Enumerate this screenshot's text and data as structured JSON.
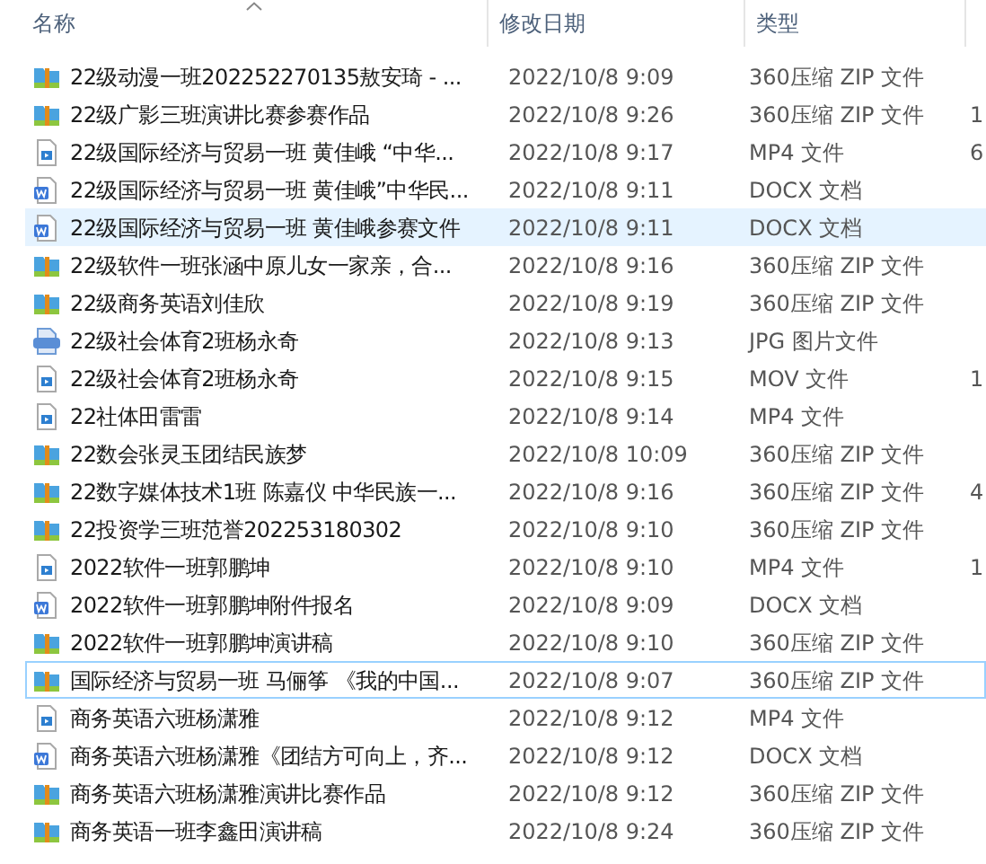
{
  "columns": [
    {
      "label": "名称"
    },
    {
      "label": "修改日期"
    },
    {
      "label": "类型"
    }
  ],
  "rows": [
    {
      "name": "22级动漫一班202252270135敖安琦 - ...",
      "date": "2022/10/8 9:09",
      "type": "360压缩 ZIP 文件",
      "kind": "zip",
      "selected": false,
      "focused": false
    },
    {
      "name": "22级广影三班演讲比赛参赛作品",
      "date": "2022/10/8 9:26",
      "type": "360压缩 ZIP 文件",
      "size": "1",
      "kind": "zip",
      "selected": false,
      "focused": false
    },
    {
      "name": "22级国际经济与贸易一班 黄佳峨 “中华...",
      "date": "2022/10/8 9:17",
      "type": "MP4 文件",
      "size": "6",
      "kind": "video",
      "selected": false,
      "focused": false
    },
    {
      "name": "22级国际经济与贸易一班 黄佳峨”中华民...",
      "date": "2022/10/8 9:11",
      "type": "DOCX 文档",
      "kind": "docx",
      "selected": false,
      "focused": false
    },
    {
      "name": "22级国际经济与贸易一班 黄佳峨参赛文件",
      "date": "2022/10/8 9:11",
      "type": "DOCX 文档",
      "kind": "docx",
      "selected": true,
      "focused": false
    },
    {
      "name": "22级软件一班张涵中原儿女一家亲，合...",
      "date": "2022/10/8 9:16",
      "type": "360压缩 ZIP 文件",
      "kind": "zip",
      "selected": false,
      "focused": false
    },
    {
      "name": "22级商务英语刘佳欣",
      "date": "2022/10/8 9:19",
      "type": "360压缩 ZIP 文件",
      "kind": "zip",
      "selected": false,
      "focused": false
    },
    {
      "name": "22级社会体育2班杨永奇",
      "date": "2022/10/8 9:13",
      "type": "JPG 图片文件",
      "kind": "jpg",
      "selected": false,
      "focused": false
    },
    {
      "name": "22级社会体育2班杨永奇",
      "date": "2022/10/8 9:15",
      "type": "MOV 文件",
      "size": "1",
      "kind": "video",
      "selected": false,
      "focused": false
    },
    {
      "name": "22社体田雷雷",
      "date": "2022/10/8 9:14",
      "type": "MP4 文件",
      "kind": "video",
      "selected": false,
      "focused": false
    },
    {
      "name": "22数会张灵玉团结民族梦",
      "date": "2022/10/8 10:09",
      "type": "360压缩 ZIP 文件",
      "kind": "zip",
      "selected": false,
      "focused": false
    },
    {
      "name": "22数字媒体技术1班 陈嘉仪 中华民族一...",
      "date": "2022/10/8 9:16",
      "type": "360压缩 ZIP 文件",
      "size": "4",
      "kind": "zip",
      "selected": false,
      "focused": false
    },
    {
      "name": "22投资学三班范誉202253180302",
      "date": "2022/10/8 9:10",
      "type": "360压缩 ZIP 文件",
      "kind": "zip",
      "selected": false,
      "focused": false
    },
    {
      "name": "2022软件一班郭鹏坤",
      "date": "2022/10/8 9:10",
      "type": "MP4 文件",
      "size": "1",
      "kind": "video",
      "selected": false,
      "focused": false
    },
    {
      "name": "2022软件一班郭鹏坤附件报名",
      "date": "2022/10/8 9:09",
      "type": "DOCX 文档",
      "kind": "docx",
      "selected": false,
      "focused": false
    },
    {
      "name": "2022软件一班郭鹏坤演讲稿",
      "date": "2022/10/8 9:10",
      "type": "360压缩 ZIP 文件",
      "kind": "zip",
      "selected": false,
      "focused": false
    },
    {
      "name": "国际经济与贸易一班 马俪筝 《我的中国...",
      "date": "2022/10/8 9:07",
      "type": "360压缩 ZIP 文件",
      "kind": "zip",
      "selected": false,
      "focused": true
    },
    {
      "name": "商务英语六班杨潇雅",
      "date": "2022/10/8 9:12",
      "type": "MP4 文件",
      "kind": "video",
      "selected": false,
      "focused": false
    },
    {
      "name": "商务英语六班杨潇雅《团结方可向上，齐...",
      "date": "2022/10/8 9:12",
      "type": "DOCX 文档",
      "kind": "docx",
      "selected": false,
      "focused": false
    },
    {
      "name": "商务英语六班杨潇雅演讲比赛作品",
      "date": "2022/10/8 9:12",
      "type": "360压缩 ZIP 文件",
      "kind": "zip",
      "selected": false,
      "focused": false
    },
    {
      "name": "商务英语一班李鑫田演讲稿",
      "date": "2022/10/8 9:24",
      "type": "360压缩 ZIP 文件",
      "kind": "zip",
      "selected": false,
      "focused": false
    }
  ]
}
